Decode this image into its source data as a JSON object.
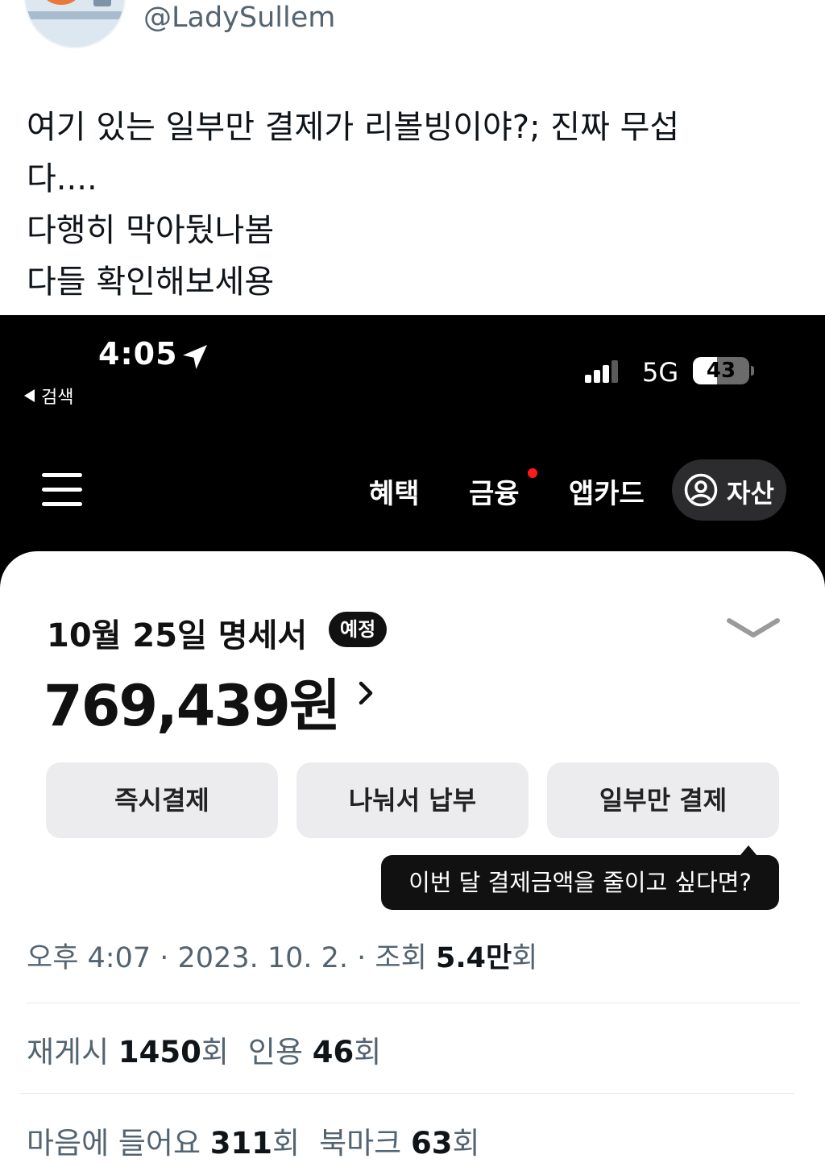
{
  "tweet": {
    "handle": "@LadySullem",
    "text_lines": [
      "여기 있는 일부만 결제가 리볼빙이야?; 진짜 무섭",
      "다....",
      "다행히 막아뒀나봄",
      "다들 확인해보세용"
    ],
    "meta": {
      "time": "오후 4:07",
      "sep": " · ",
      "date": "2023. 10. 2.",
      "views_label": "조회",
      "views_value": "5.4만",
      "views_suffix": "회"
    },
    "stats": {
      "retweets_label": "재게시",
      "retweets_value": "1450",
      "quotes_label": "인용",
      "quotes_value": "46",
      "likes_label": "마음에 들어요",
      "likes_value": "311",
      "bookmarks_label": "북마크",
      "bookmarks_value": "63",
      "count_suffix": "회"
    }
  },
  "phone": {
    "status_bar": {
      "time": "4:05",
      "back_label": "검색",
      "network": "5G",
      "battery_level": "43",
      "battery_fraction": 0.43,
      "location-icon": "location-arrow-icon",
      "signal_bars_active": 3
    },
    "nav": {
      "menu_icon": "hamburger-menu-icon",
      "items": [
        "혜택",
        "금융",
        "앱카드"
      ],
      "notification_dot_color": "#ff1a1a",
      "asset_label": "자산",
      "asset_icon": "person-circle-icon"
    },
    "statement": {
      "title": "10월 25일 명세서",
      "badge": "예정",
      "amount": "769,439원",
      "collapse_icon": "chevron-down-icon",
      "amount_arrow_icon": "chevron-right-icon",
      "buttons": [
        "즉시결제",
        "나눠서 납부",
        "일부만 결제"
      ],
      "tooltip": "이번 달 결제금액을 줄이고 싶다면?"
    }
  },
  "colors": {
    "text_primary": "#0f1419",
    "text_secondary": "#536471",
    "phone_bg": "#000000",
    "button_bg": "#ececee"
  }
}
